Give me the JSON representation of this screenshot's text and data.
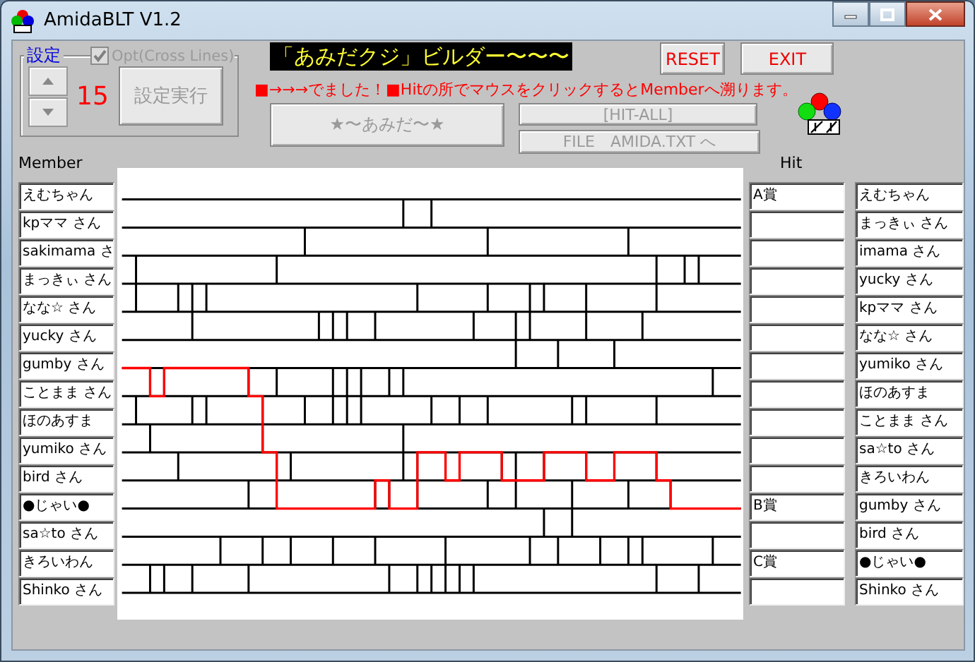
{
  "window": {
    "title": "AmidaBLT V1.2"
  },
  "settings": {
    "label": "設定",
    "cross_lines": {
      "label": "Opt(Cross Lines)",
      "checked": true,
      "disabled": true
    },
    "count": "15",
    "apply_button": {
      "label": "設定実行",
      "disabled": true
    }
  },
  "banner": "「あみだクジ」ビルダー〜〜〜",
  "message": "■→→→でました！■Hitの所でマウスをクリックするとMemberへ溯ります。",
  "reset_button": {
    "label": "RESET",
    "disabled": false
  },
  "exit_button": {
    "label": "EXIT",
    "disabled": false
  },
  "amida_button": {
    "label": "★〜あみだ〜★",
    "disabled": true
  },
  "hit_all_button": {
    "label": "[HIT-ALL]",
    "disabled": true
  },
  "file_button": {
    "label": "FILE　AMIDA.TXT へ",
    "disabled": true
  },
  "member_header": "Member",
  "hit_header": "Hit",
  "rows": [
    {
      "member": "えむちゃん",
      "hit": "A賞",
      "result": "えむちゃん"
    },
    {
      "member": "kpママ さん",
      "result": "まっきぃ さん"
    },
    {
      "member": "sakimama さ",
      "result": "imama さん"
    },
    {
      "member": "まっきぃ さん",
      "result": "yucky さん"
    },
    {
      "member": "なな☆ さん",
      "result": "kpママ さん"
    },
    {
      "member": "yucky さん",
      "result": "なな☆ さん"
    },
    {
      "member": "gumby さん",
      "result": "yumiko さん"
    },
    {
      "member": "ことまま さん",
      "result": "ほのあすま"
    },
    {
      "member": "ほのあすま",
      "result": "ことまま さん"
    },
    {
      "member": "yumiko さん",
      "result": "sa☆to さん"
    },
    {
      "member": "bird さん",
      "result": "きろいわん"
    },
    {
      "member": "●じゃい●",
      "hit": "B賞",
      "result": "gumby さん"
    },
    {
      "member": "sa☆to さん",
      "result": "bird さん"
    },
    {
      "member": "きろいわん",
      "hit": "C賞",
      "result": "●じゃい●"
    },
    {
      "member": "Shinko さん",
      "result": "Shinko さん"
    }
  ]
}
